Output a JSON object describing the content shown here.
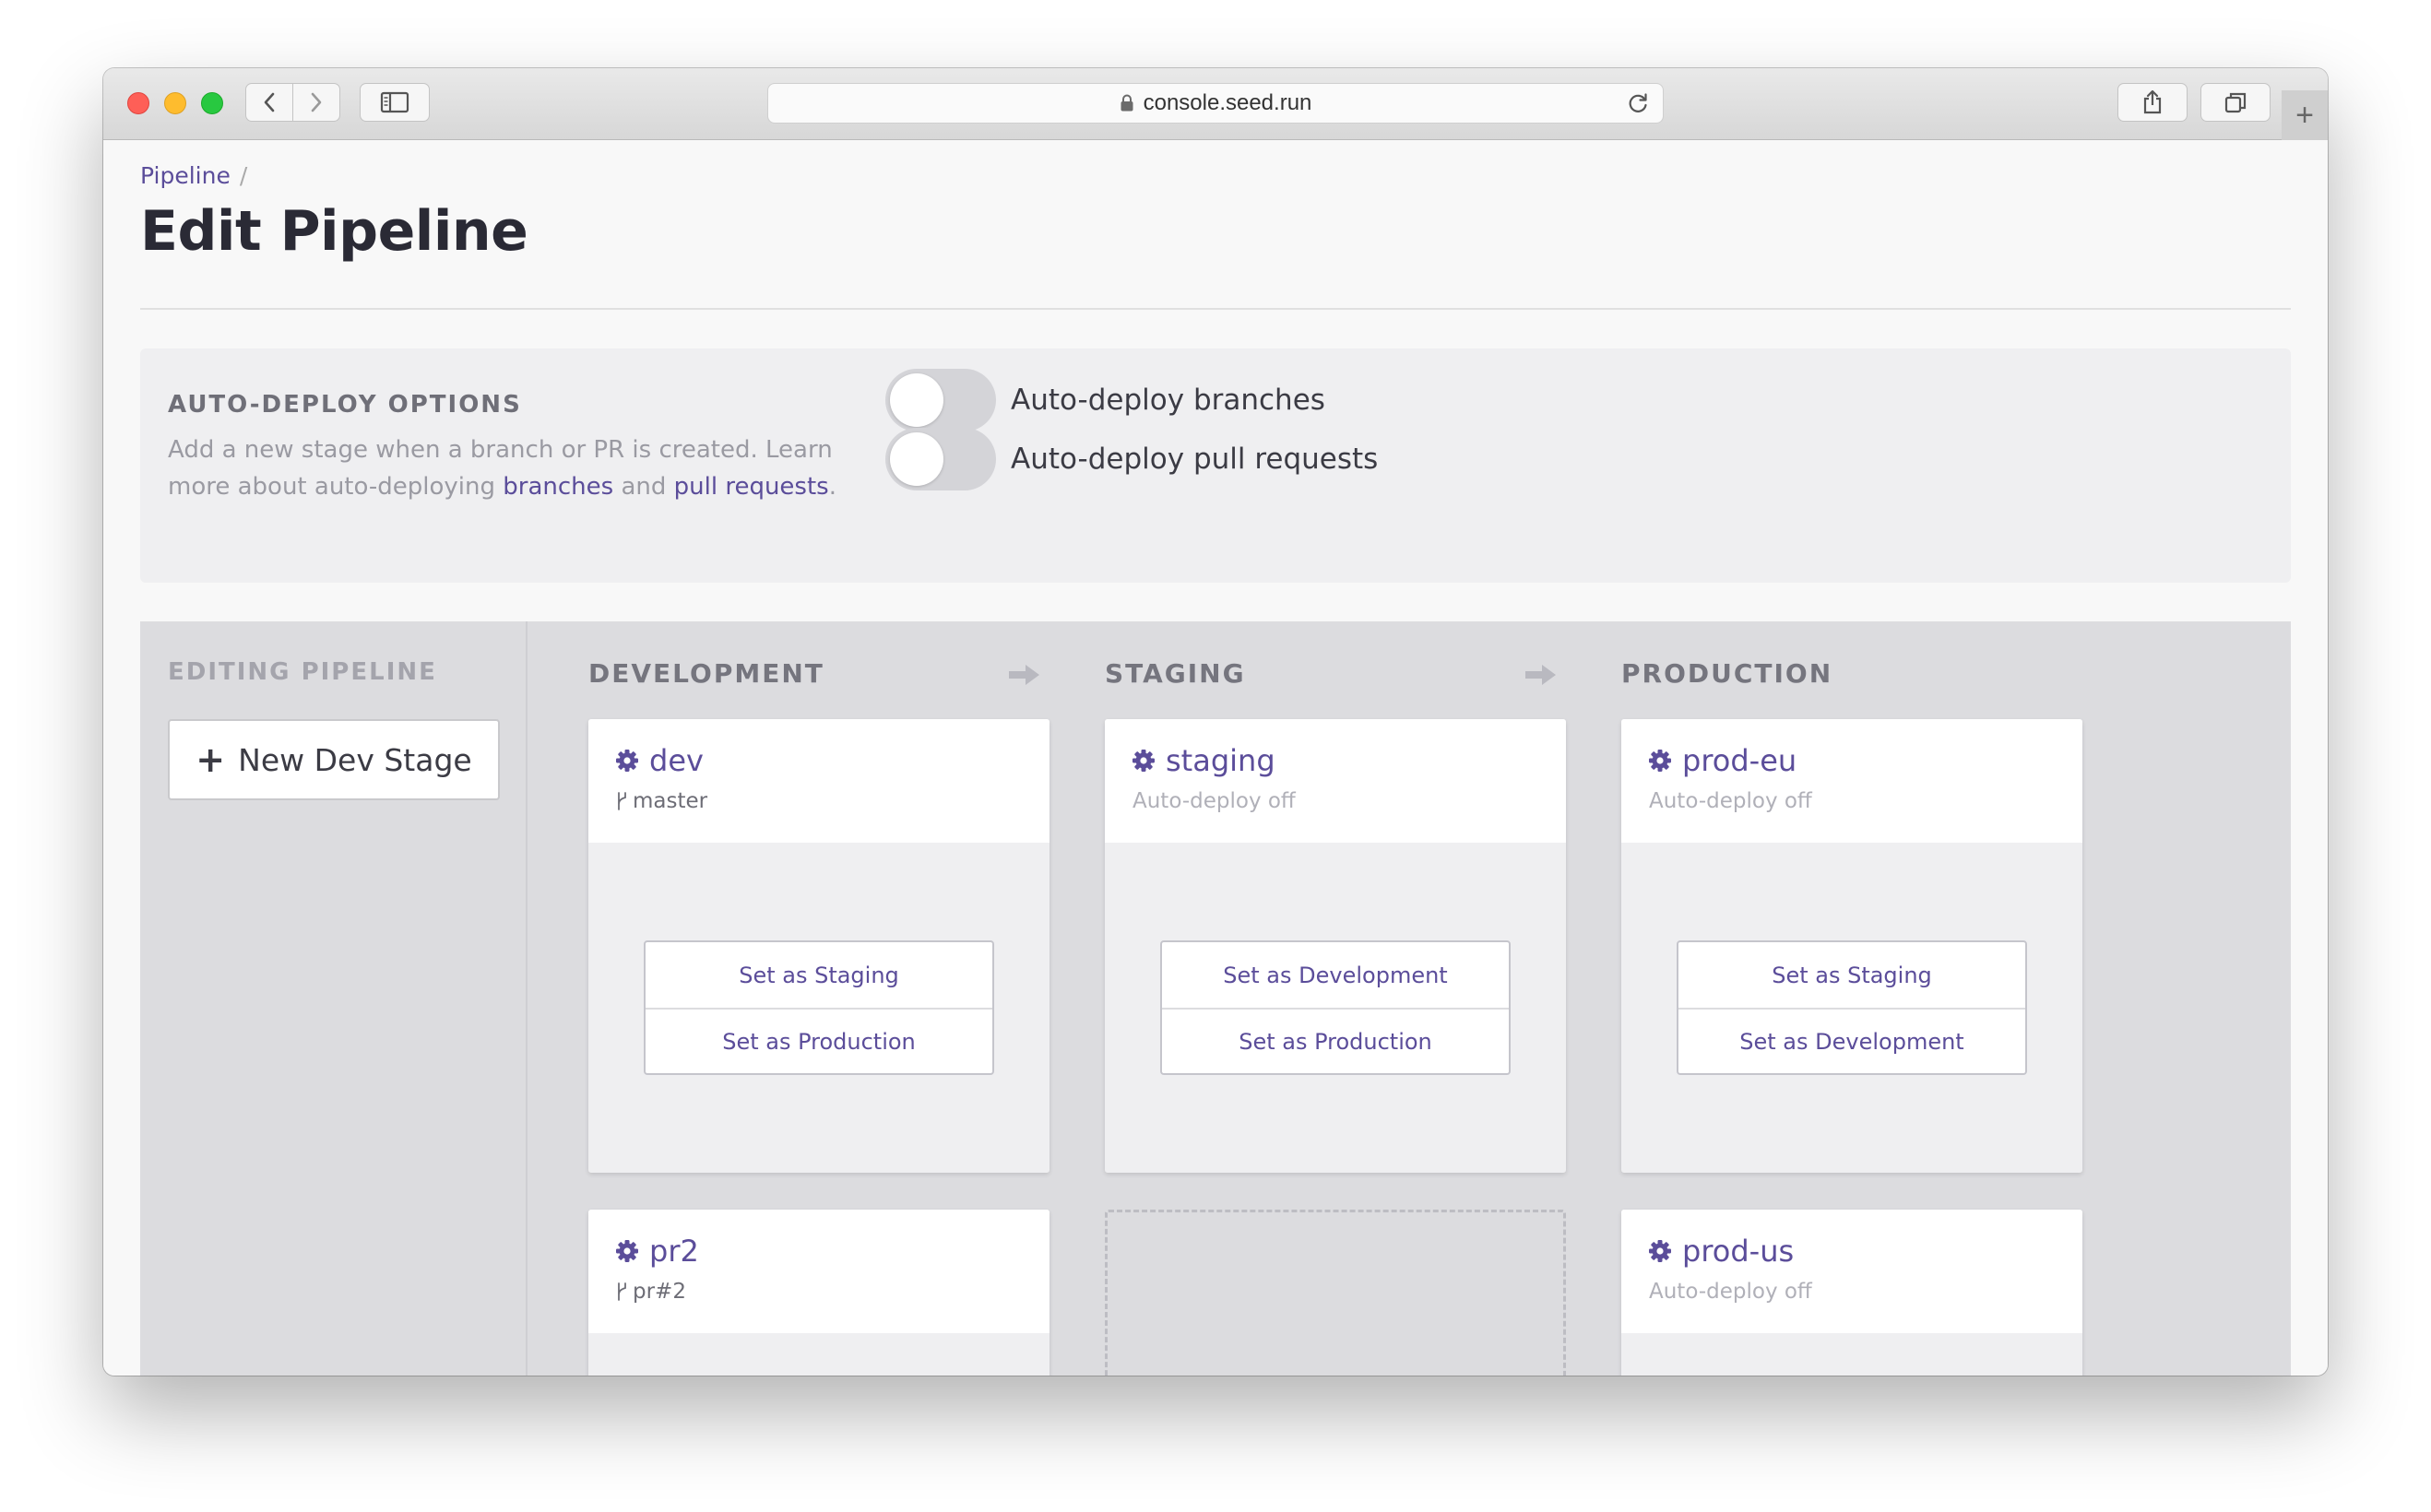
{
  "browser": {
    "url": "console.seed.run"
  },
  "breadcrumb": {
    "items": [
      "Pipeline"
    ],
    "separator": "/"
  },
  "page": {
    "title": "Edit Pipeline"
  },
  "auto_deploy": {
    "heading": "AUTO-DEPLOY OPTIONS",
    "description_pre": "Add a new stage when a branch or PR is created. Learn more about auto-deploying ",
    "link_branches": "branches",
    "description_mid": " and ",
    "link_pull_requests": "pull requests",
    "description_post": ".",
    "toggles": [
      {
        "label": "Auto-deploy branches",
        "on": false
      },
      {
        "label": "Auto-deploy pull requests",
        "on": false
      }
    ]
  },
  "pipeline": {
    "editing_heading": "EDITING PIPELINE",
    "new_stage_label": "New Dev Stage",
    "columns": [
      {
        "heading": "DEVELOPMENT"
      },
      {
        "heading": "STAGING"
      },
      {
        "heading": "PRODUCTION"
      }
    ],
    "stages": {
      "dev": {
        "name": "dev",
        "subtitle": "master",
        "actions": [
          "Set as Staging",
          "Set as Production"
        ]
      },
      "pr2": {
        "name": "pr2",
        "subtitle": "pr#2"
      },
      "staging": {
        "name": "staging",
        "subtitle": "Auto-deploy off",
        "actions": [
          "Set as Development",
          "Set as Production"
        ]
      },
      "prod_eu": {
        "name": "prod-eu",
        "subtitle": "Auto-deploy off",
        "actions": [
          "Set as Staging",
          "Set as Development"
        ]
      },
      "prod_us": {
        "name": "prod-us",
        "subtitle": "Auto-deploy off"
      }
    }
  },
  "colors": {
    "accent": "#5b4d9a",
    "toggle_off": "#d4d4d8"
  }
}
